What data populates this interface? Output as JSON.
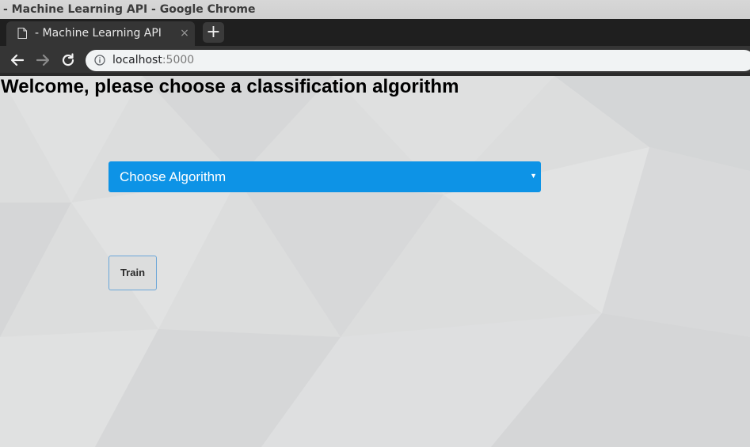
{
  "window": {
    "title": "- Machine Learning API - Google Chrome"
  },
  "tabs": [
    {
      "label": "- Machine Learning API",
      "close_glyph": "×",
      "active": true
    }
  ],
  "newtab": {
    "glyph": "+"
  },
  "toolbar": {
    "back_icon": "arrow-left-icon",
    "forward_icon": "arrow-right-icon",
    "reload_icon": "reload-icon",
    "site_info_icon": "info-icon",
    "url_host": "localhost",
    "url_port": ":5000"
  },
  "page": {
    "heading": "Welcome, please choose a classification algorithm",
    "select": {
      "selected": "Choose Algorithm",
      "caret": "▼"
    },
    "train_button": "Train"
  },
  "colors": {
    "select_bg": "#0d93e6",
    "page_bg": "#dcdddd",
    "button_border": "#6aa6d8"
  }
}
